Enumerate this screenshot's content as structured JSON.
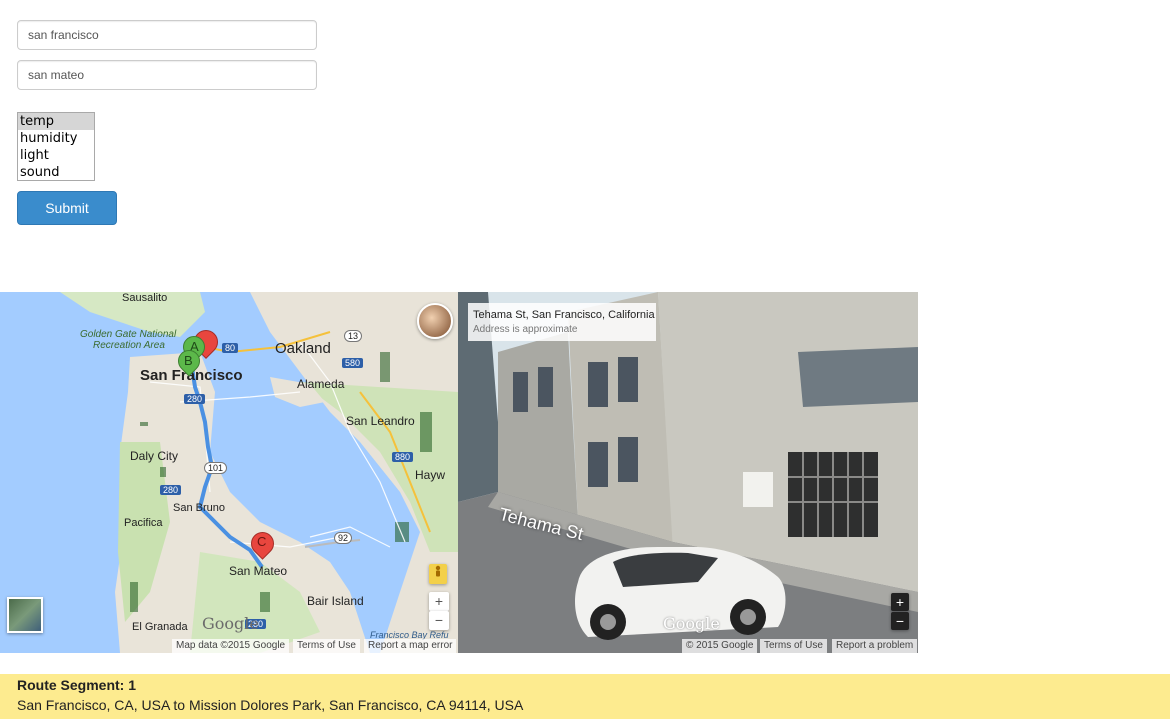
{
  "form": {
    "from_value": "san francisco",
    "to_value": "san mateo",
    "sensor_options": [
      "temp",
      "humidity",
      "light",
      "sound"
    ],
    "selected_option": "temp",
    "submit_label": "Submit"
  },
  "map": {
    "labels": {
      "sausalito": "Sausalito",
      "golden_gate": "Golden Gate National",
      "recreation": "Recreation Area",
      "oakland": "Oakland",
      "alameda": "Alameda",
      "san_francisco": "San Francisco",
      "san_leandro": "San Leandro",
      "hayward": "Hayw",
      "daly_city": "Daly City",
      "san_bruno": "San Bruno",
      "pacifica": "Pacifica",
      "san_mateo": "San Mateo",
      "bair_island": "Bair Island",
      "el_granada": "El Granada",
      "foster_city": "Francisco Bay Refu"
    },
    "shields": {
      "i80": "80",
      "i580": "580",
      "i880": "880",
      "i280a": "280",
      "i280b": "280",
      "i280c": "280",
      "r13": "13",
      "r101": "101",
      "r92": "92"
    },
    "markers": {
      "a": "A",
      "b": "B",
      "c": "C"
    },
    "logo": "Google",
    "footer": {
      "map_data": "Map data ©2015 Google",
      "terms": "Terms of Use",
      "report": "Report a map error"
    },
    "zoom_in": "+",
    "zoom_out": "−"
  },
  "streetview": {
    "address": "Tehama St, San Francisco, California",
    "approx": "Address is approximate",
    "street_label": "Tehama St",
    "logo": "Google",
    "footer": {
      "copyright": "© 2015 Google",
      "terms": "Terms of Use",
      "report": "Report a problem"
    },
    "zoom_in": "+",
    "zoom_out": "−"
  },
  "segment": {
    "title": "Route Segment: 1",
    "text": "San Francisco, CA, USA to Mission Dolores Park, San Francisco, CA 94114, USA"
  },
  "colors": {
    "accent": "#3a8ccc",
    "route": "#4a90e2",
    "segment_bg": "#fdeb8f",
    "marker_red": "#e8463e",
    "marker_green": "#5cb84a"
  }
}
